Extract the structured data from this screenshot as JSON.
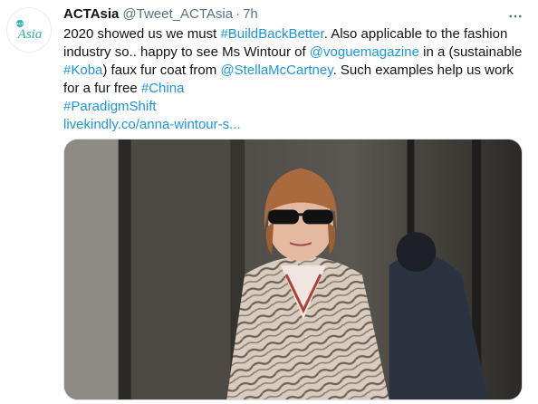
{
  "tweet": {
    "author_name": "ACTAsia",
    "author_handle": "@Tweet_ACTAsia",
    "separator": "·",
    "time": "7h",
    "avatar_logo_text": "Asia",
    "avatar_logo_small": "ACT",
    "lines": [
      [
        {
          "text": "2020 showed us we must ",
          "link": false
        },
        {
          "text": "#BuildBackBetter",
          "link": true
        },
        {
          "text": ". Also applicable to the fashion",
          "link": false
        }
      ],
      [
        {
          "text": "industry so.. happy to see Ms Wintour of ",
          "link": false
        },
        {
          "text": "@voguemagazine",
          "link": true
        },
        {
          "text": " in a (sustainable",
          "link": false
        }
      ],
      [
        {
          "text": "#Koba",
          "link": true
        },
        {
          "text": ") faux fur coat from ",
          "link": false
        },
        {
          "text": "@StellaMcCartney",
          "link": true
        },
        {
          "text": ". Such examples help us work",
          "link": false
        }
      ],
      [
        {
          "text": "for a fur free ",
          "link": false
        },
        {
          "text": "#China",
          "link": true
        }
      ],
      [
        {
          "text": "#ParadigmShift",
          "link": true
        }
      ],
      [
        {
          "text": "livekindly.co/anna-wintour-s...",
          "link": true
        }
      ]
    ],
    "more_icon": "more-horizontal-icon",
    "colors": {
      "link": "#1b95e0",
      "secondary": "#5b7083",
      "logo_teal": "#2bb3a8"
    }
  }
}
